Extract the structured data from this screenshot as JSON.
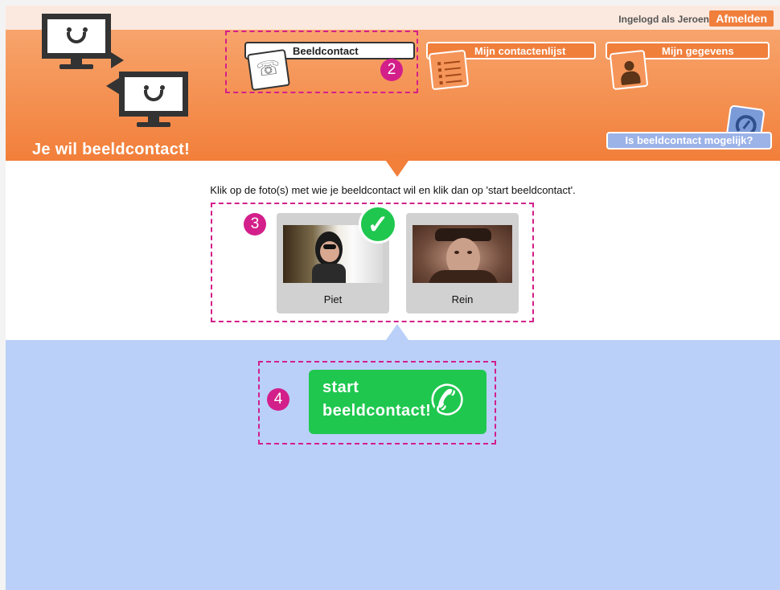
{
  "topbar": {
    "login_text": "Ingelogd als Jeroen",
    "logout_label": "Afmelden"
  },
  "header": {
    "title": "Je wil beeldcontact!",
    "tabs": [
      {
        "label": "Beeldcontact",
        "active": true,
        "icon": "phone-icon"
      },
      {
        "label": "Mijn contactenlijst",
        "active": false,
        "icon": "list-icon"
      },
      {
        "label": "Mijn gegevens",
        "active": false,
        "icon": "person-icon"
      }
    ],
    "check_button": "Is beeldcontact mogelijk?"
  },
  "main": {
    "instruction": "Klik op de foto(s) met wie je beeldcontact wil en klik dan op 'start beeldcontact'.",
    "contacts": [
      {
        "name": "Piet",
        "selected": true
      },
      {
        "name": "Rein",
        "selected": false
      }
    ]
  },
  "start_button": {
    "line1": "start",
    "line2": "beeldcontact!"
  },
  "callouts": [
    "2",
    "3",
    "4"
  ],
  "colors": {
    "orange": "#f27f3a",
    "green": "#1fc74f",
    "blue": "#bad0f9",
    "magenta": "#d31f8a"
  }
}
